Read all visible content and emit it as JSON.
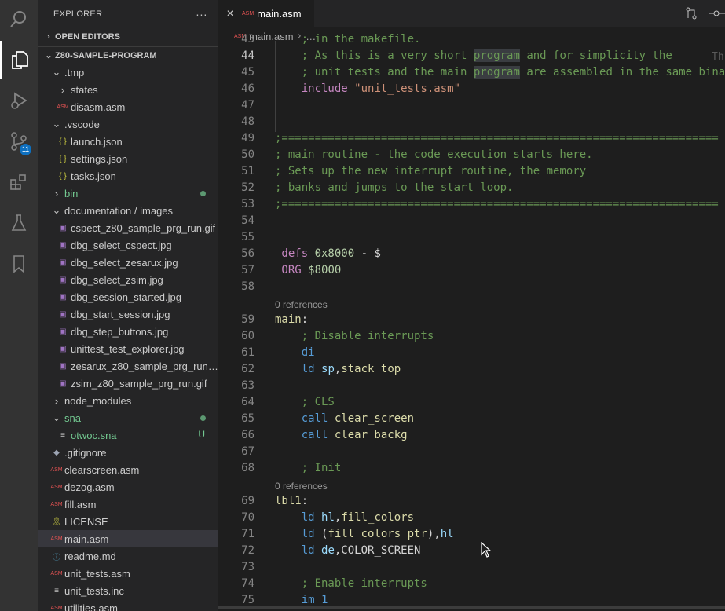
{
  "activity": {
    "scm_badge": "11",
    "icons": [
      "search-icon",
      "files-icon",
      "debug-icon",
      "source-control-icon",
      "extensions-icon",
      "testing-icon",
      "bookmarks-icon"
    ]
  },
  "explorer": {
    "title": "EXPLORER",
    "more": "···",
    "open_editors": "OPEN EDITORS",
    "project": "Z80-SAMPLE-PROGRAM",
    "items": [
      {
        "label": ".tmp",
        "type": "folder",
        "open": true,
        "depth": 1
      },
      {
        "label": "states",
        "type": "folder",
        "open": false,
        "depth": 2
      },
      {
        "label": "disasm.asm",
        "type": "asm",
        "depth": 2
      },
      {
        "label": ".vscode",
        "type": "folder",
        "open": true,
        "depth": 1
      },
      {
        "label": "launch.json",
        "type": "json",
        "depth": 2
      },
      {
        "label": "settings.json",
        "type": "json",
        "depth": 2
      },
      {
        "label": "tasks.json",
        "type": "json",
        "depth": 2
      },
      {
        "label": "bin",
        "type": "folder",
        "open": false,
        "depth": 1,
        "git": true
      },
      {
        "label": "documentation / images",
        "type": "folder",
        "open": true,
        "depth": 1
      },
      {
        "label": "cspect_z80_sample_prg_run.gif",
        "type": "img",
        "depth": 2
      },
      {
        "label": "dbg_select_cspect.jpg",
        "type": "img",
        "depth": 2
      },
      {
        "label": "dbg_select_zesarux.jpg",
        "type": "img",
        "depth": 2
      },
      {
        "label": "dbg_select_zsim.jpg",
        "type": "img",
        "depth": 2
      },
      {
        "label": "dbg_session_started.jpg",
        "type": "img",
        "depth": 2
      },
      {
        "label": "dbg_start_session.jpg",
        "type": "img",
        "depth": 2
      },
      {
        "label": "dbg_step_buttons.jpg",
        "type": "img",
        "depth": 2
      },
      {
        "label": "unittest_test_explorer.jpg",
        "type": "img",
        "depth": 2
      },
      {
        "label": "zesarux_z80_sample_prg_run.gif",
        "type": "img",
        "depth": 2
      },
      {
        "label": "zsim_z80_sample_prg_run.gif",
        "type": "img",
        "depth": 2
      },
      {
        "label": "node_modules",
        "type": "folder",
        "open": false,
        "depth": 1
      },
      {
        "label": "sna",
        "type": "folder",
        "open": true,
        "depth": 1,
        "git": true
      },
      {
        "label": "otwoc.sna",
        "type": "lines",
        "depth": 2,
        "status": "U"
      },
      {
        "label": ".gitignore",
        "type": "git",
        "depth": 1
      },
      {
        "label": "clearscreen.asm",
        "type": "asm",
        "depth": 1
      },
      {
        "label": "dezog.asm",
        "type": "asm",
        "depth": 1
      },
      {
        "label": "fill.asm",
        "type": "asm",
        "depth": 1
      },
      {
        "label": "LICENSE",
        "type": "license",
        "depth": 1
      },
      {
        "label": "main.asm",
        "type": "asm",
        "depth": 1,
        "selected": true
      },
      {
        "label": "readme.md",
        "type": "info",
        "depth": 1
      },
      {
        "label": "unit_tests.asm",
        "type": "asm",
        "depth": 1
      },
      {
        "label": "unit_tests.inc",
        "type": "lines",
        "depth": 1
      },
      {
        "label": "utilities.asm",
        "type": "asm",
        "depth": 1
      }
    ]
  },
  "editor": {
    "tab_label": "main.asm",
    "tab_close": "×",
    "asm_badge": "ASM",
    "breadcrumb_file": "main.asm",
    "breadcrumb_more": "…",
    "lines": [
      {
        "n": "43",
        "s": [
          [
            "c-com",
            "    ; in the makefile."
          ]
        ]
      },
      {
        "n": "44",
        "cur": true,
        "s": [
          [
            "c-com",
            "    ; As this is a very short "
          ],
          [
            "c-com hl",
            "program"
          ],
          [
            "c-com",
            " and for simplicity the"
          ]
        ]
      },
      {
        "n": "45",
        "s": [
          [
            "c-com",
            "    ; unit tests and the main "
          ],
          [
            "c-com hl",
            "program"
          ],
          [
            "c-com",
            " are assembled in the same bina"
          ]
        ]
      },
      {
        "n": "46",
        "s": [
          [
            "c-kw",
            "    include "
          ],
          [
            "c-str",
            "\"unit_tests.asm\""
          ]
        ]
      },
      {
        "n": "47",
        "s": []
      },
      {
        "n": "48",
        "s": []
      },
      {
        "n": "49",
        "s": [
          [
            "c-com",
            ";=================================================================="
          ]
        ]
      },
      {
        "n": "50",
        "s": [
          [
            "c-com",
            "; main routine - the code execution starts here."
          ]
        ]
      },
      {
        "n": "51",
        "s": [
          [
            "c-com",
            "; Sets up the new interrupt routine, the memory"
          ]
        ]
      },
      {
        "n": "52",
        "s": [
          [
            "c-com",
            "; banks and jumps to the start loop."
          ]
        ]
      },
      {
        "n": "53",
        "s": [
          [
            "c-com",
            ";=================================================================="
          ]
        ]
      },
      {
        "n": "54",
        "s": []
      },
      {
        "n": "55",
        "s": []
      },
      {
        "n": "56",
        "s": [
          [
            "c-kw",
            " defs "
          ],
          [
            "c-num",
            "0x8000"
          ],
          [
            "",
            " - $"
          ]
        ]
      },
      {
        "n": "57",
        "s": [
          [
            "c-kw",
            " ORG "
          ],
          [
            "c-num",
            "$8000"
          ]
        ]
      },
      {
        "n": "58",
        "s": []
      },
      {
        "lens": "0 references"
      },
      {
        "n": "59",
        "s": [
          [
            "c-lbl",
            "main"
          ],
          [
            "",
            ":"
          ]
        ]
      },
      {
        "n": "60",
        "s": [
          [
            "c-com",
            "    ; Disable interrupts"
          ]
        ]
      },
      {
        "n": "61",
        "s": [
          [
            "c-ins",
            "    di"
          ]
        ]
      },
      {
        "n": "62",
        "s": [
          [
            "c-ins",
            "    ld "
          ],
          [
            "c-reg",
            "sp"
          ],
          [
            "",
            ","
          ],
          [
            "c-lbl",
            "stack_top"
          ]
        ]
      },
      {
        "n": "63",
        "s": []
      },
      {
        "n": "64",
        "s": [
          [
            "c-com",
            "    ; CLS"
          ]
        ]
      },
      {
        "n": "65",
        "s": [
          [
            "c-ins",
            "    call "
          ],
          [
            "c-lbl",
            "clear_screen"
          ]
        ]
      },
      {
        "n": "66",
        "s": [
          [
            "c-ins",
            "    call "
          ],
          [
            "c-lbl",
            "clear_backg"
          ]
        ]
      },
      {
        "n": "67",
        "s": []
      },
      {
        "n": "68",
        "s": [
          [
            "c-com",
            "    ; Init"
          ]
        ]
      },
      {
        "lens": "0 references"
      },
      {
        "n": "69",
        "s": [
          [
            "c-lbl",
            "lbl1"
          ],
          [
            "",
            ":"
          ]
        ]
      },
      {
        "n": "70",
        "s": [
          [
            "c-ins",
            "    ld "
          ],
          [
            "c-reg",
            "hl"
          ],
          [
            "",
            ","
          ],
          [
            "c-lbl",
            "fill_colors"
          ]
        ]
      },
      {
        "n": "71",
        "s": [
          [
            "c-ins",
            "    ld "
          ],
          [
            "",
            "("
          ],
          [
            "c-lbl",
            "fill_colors_ptr"
          ],
          [
            "",
            "),"
          ],
          [
            "c-reg",
            "hl"
          ]
        ]
      },
      {
        "n": "72",
        "s": [
          [
            "c-ins",
            "    ld "
          ],
          [
            "c-reg",
            "de"
          ],
          [
            "",
            ",COLOR_SCREEN"
          ]
        ]
      },
      {
        "n": "73",
        "s": []
      },
      {
        "n": "74",
        "s": [
          [
            "c-com",
            "    ; Enable interrupts"
          ]
        ]
      },
      {
        "n": "75",
        "s": [
          [
            "c-ins",
            "    im 1"
          ]
        ]
      }
    ],
    "ghost": "Th"
  }
}
